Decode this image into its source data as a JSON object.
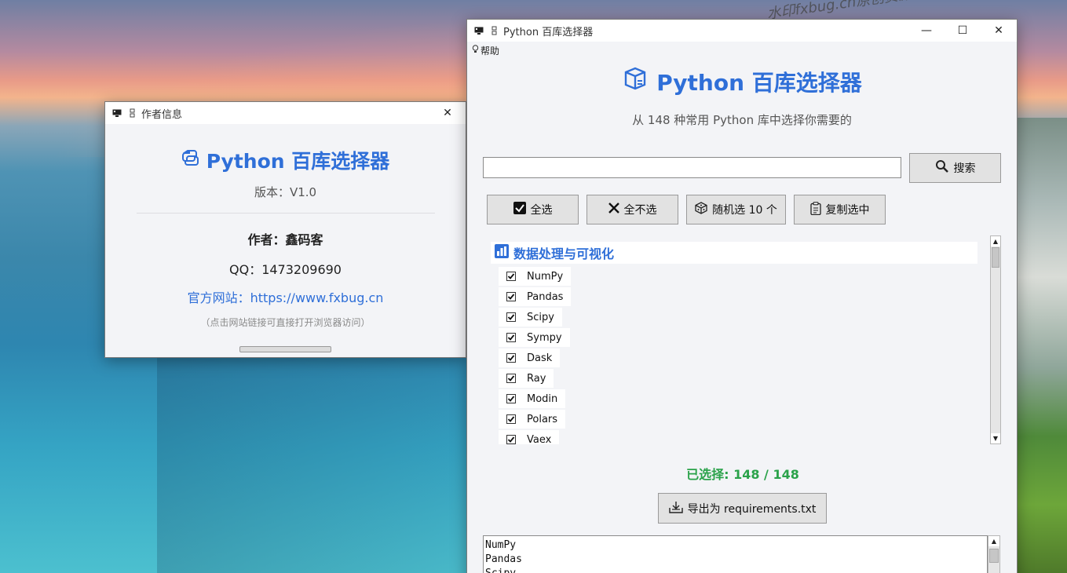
{
  "watermark": "水印fxbug.cn原创资源!",
  "about": {
    "window_title": "作者信息",
    "close_glyph": "✕",
    "title": "Python 百库选择器",
    "version": "版本：V1.0",
    "author": "作者：鑫码客",
    "qq": "QQ：1473209690",
    "site": "官方网站：https://www.fxbug.cn",
    "hint": "（点击网站链接可直接打开浏览器访问）"
  },
  "main": {
    "window_title": "Python 百库选择器",
    "minimize_glyph": "—",
    "maximize_glyph": "☐",
    "close_glyph": "✕",
    "menu_help": "帮助",
    "title": "Python 百库选择器",
    "subtitle": "从 148 种常用 Python 库中选择你需要的",
    "search": {
      "value": "",
      "button": "搜索"
    },
    "toolbar": {
      "select_all": "全选",
      "select_none": "全不选",
      "random": "随机选 10 个",
      "copy": "复制选中"
    },
    "category": "数据处理与可视化",
    "libraries": [
      "NumPy",
      "Pandas",
      "Scipy",
      "Sympy",
      "Dask",
      "Ray",
      "Modin",
      "Polars",
      "Vaex"
    ],
    "selected_count": "已选择: 148 / 148",
    "export_button": "导出为 requirements.txt",
    "output_lines": [
      "NumPy",
      "Pandas",
      "Scipy"
    ]
  },
  "colors": {
    "accent": "#2f6fd8",
    "success": "#2aa24a"
  }
}
